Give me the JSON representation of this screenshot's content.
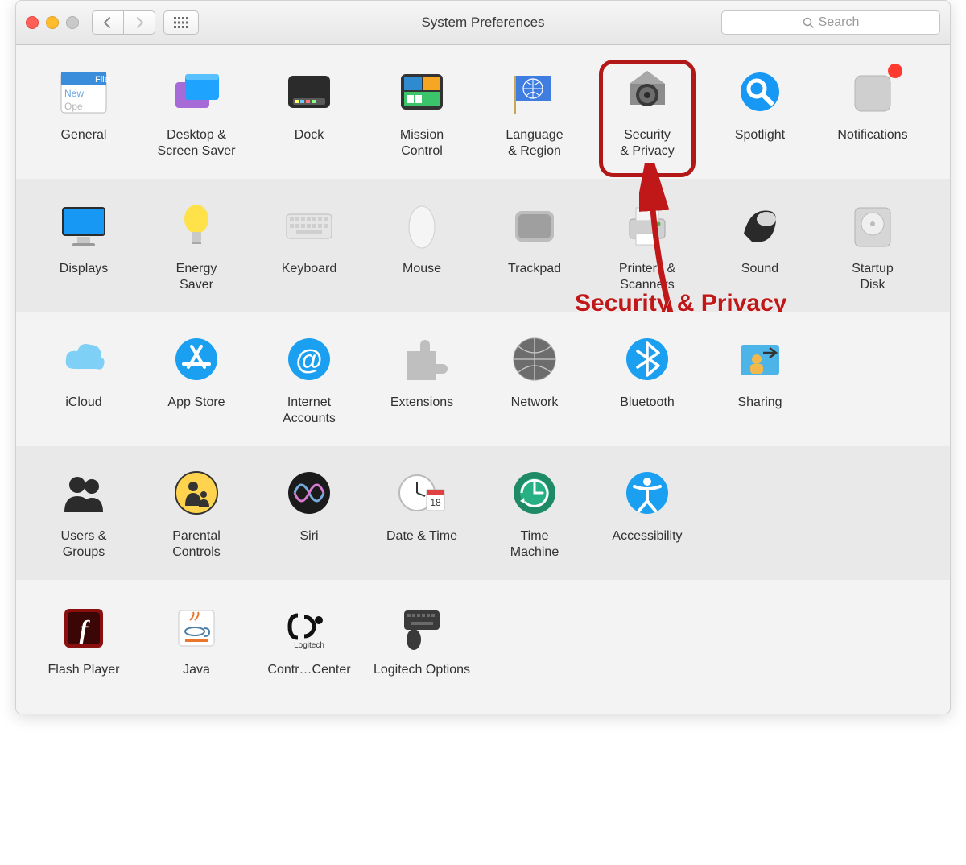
{
  "window": {
    "title": "System Preferences"
  },
  "search": {
    "placeholder": "Search"
  },
  "annotation": {
    "label": "Security & Privacy"
  },
  "highlight_target": "security-privacy",
  "rows": [
    {
      "bg": "light",
      "items": [
        {
          "id": "general",
          "label": "General"
        },
        {
          "id": "desktop",
          "label": "Desktop &\nScreen Saver"
        },
        {
          "id": "dock",
          "label": "Dock"
        },
        {
          "id": "mission-control",
          "label": "Mission\nControl"
        },
        {
          "id": "language-region",
          "label": "Language\n& Region"
        },
        {
          "id": "security-privacy",
          "label": "Security\n& Privacy"
        },
        {
          "id": "spotlight",
          "label": "Spotlight"
        },
        {
          "id": "notifications",
          "label": "Notifications",
          "badge": true
        }
      ]
    },
    {
      "bg": "alt",
      "items": [
        {
          "id": "displays",
          "label": "Displays"
        },
        {
          "id": "energy-saver",
          "label": "Energy\nSaver"
        },
        {
          "id": "keyboard",
          "label": "Keyboard"
        },
        {
          "id": "mouse",
          "label": "Mouse"
        },
        {
          "id": "trackpad",
          "label": "Trackpad"
        },
        {
          "id": "printers-scanners",
          "label": "Printers &\nScanners"
        },
        {
          "id": "sound",
          "label": "Sound"
        },
        {
          "id": "startup-disk",
          "label": "Startup\nDisk"
        }
      ]
    },
    {
      "bg": "light",
      "items": [
        {
          "id": "icloud",
          "label": "iCloud"
        },
        {
          "id": "app-store",
          "label": "App Store"
        },
        {
          "id": "internet-accounts",
          "label": "Internet\nAccounts"
        },
        {
          "id": "extensions",
          "label": "Extensions"
        },
        {
          "id": "network",
          "label": "Network"
        },
        {
          "id": "bluetooth",
          "label": "Bluetooth"
        },
        {
          "id": "sharing",
          "label": "Sharing"
        }
      ]
    },
    {
      "bg": "alt",
      "items": [
        {
          "id": "users-groups",
          "label": "Users &\nGroups"
        },
        {
          "id": "parental-controls",
          "label": "Parental\nControls"
        },
        {
          "id": "siri",
          "label": "Siri"
        },
        {
          "id": "date-time",
          "label": "Date & Time"
        },
        {
          "id": "time-machine",
          "label": "Time\nMachine"
        },
        {
          "id": "accessibility",
          "label": "Accessibility"
        }
      ]
    },
    {
      "bg": "light",
      "items": [
        {
          "id": "flash-player",
          "label": "Flash Player"
        },
        {
          "id": "java",
          "label": "Java"
        },
        {
          "id": "control-center",
          "label": "Contr…Center"
        },
        {
          "id": "logitech-options",
          "label": "Logitech Options"
        }
      ]
    }
  ]
}
